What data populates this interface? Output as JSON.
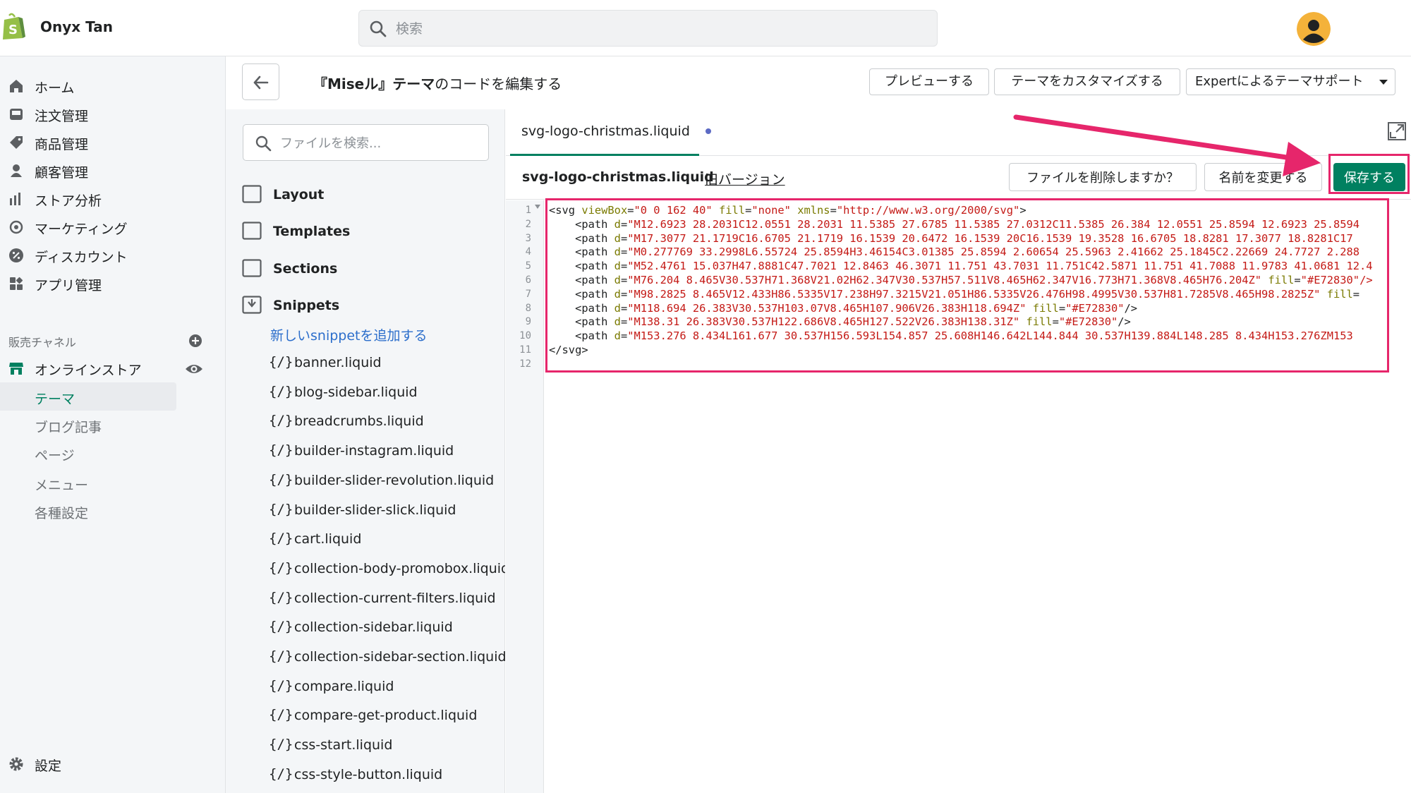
{
  "topbar": {
    "store_name": "Onyx Tan",
    "search_placeholder": "検索"
  },
  "sidebar": {
    "items": [
      {
        "label": "ホーム",
        "icon": "home-icon"
      },
      {
        "label": "注文管理",
        "icon": "orders-icon"
      },
      {
        "label": "商品管理",
        "icon": "tag-icon"
      },
      {
        "label": "顧客管理",
        "icon": "person-icon"
      },
      {
        "label": "ストア分析",
        "icon": "analytics-icon"
      },
      {
        "label": "マーケティング",
        "icon": "target-icon"
      },
      {
        "label": "ディスカウント",
        "icon": "discount-icon"
      },
      {
        "label": "アプリ管理",
        "icon": "apps-icon"
      }
    ],
    "channels_heading": "販売チャネル",
    "online_store": "オンラインストア",
    "sub_items": [
      {
        "label": "テーマ",
        "active": true
      },
      {
        "label": "ブログ記事",
        "active": false
      },
      {
        "label": "ページ",
        "active": false
      },
      {
        "label": "メニュー",
        "active": false
      },
      {
        "label": "各種設定",
        "active": false
      }
    ],
    "settings": "設定"
  },
  "header": {
    "title_quote_open": "『",
    "title_theme": "Miseル",
    "title_quote_close": "』テーマ",
    "title_rest": "のコードを編集する",
    "preview_button": "プレビューする",
    "customize_button": "テーマをカスタマイズする",
    "expert_button": "Expertによるテーマサポート"
  },
  "files": {
    "search_placeholder": "ファイルを検索...",
    "folders": [
      "Layout",
      "Templates",
      "Sections",
      "Snippets"
    ],
    "add_snippet": "新しいsnippetを追加する",
    "file_icon": "{/}",
    "snippets": [
      "banner.liquid",
      "blog-sidebar.liquid",
      "breadcrumbs.liquid",
      "builder-instagram.liquid",
      "builder-slider-revolution.liquid",
      "builder-slider-slick.liquid",
      "cart.liquid",
      "collection-body-promobox.liquid",
      "collection-current-filters.liquid",
      "collection-sidebar.liquid",
      "collection-sidebar-section.liquid",
      "compare.liquid",
      "compare-get-product.liquid",
      "css-start.liquid",
      "css-style-button.liquid"
    ]
  },
  "editor": {
    "tab_name": "svg-logo-christmas.liquid",
    "file_name": "svg-logo-christmas.liquid",
    "old_version": "旧バージョン",
    "delete_button": "ファイルを削除しますか？",
    "rename_button": "名前を変更する",
    "save_button": "保存する",
    "line_numbers": [
      "1",
      "2",
      "3",
      "4",
      "5",
      "6",
      "7",
      "8",
      "9",
      "10",
      "11",
      "12"
    ],
    "code_lines": [
      [
        {
          "t": "tag",
          "v": "<svg "
        },
        {
          "t": "attr",
          "v": "viewBox"
        },
        {
          "t": "tag",
          "v": "="
        },
        {
          "t": "str",
          "v": "\"0 0 162 40\""
        },
        {
          "t": "tag",
          "v": " "
        },
        {
          "t": "attr",
          "v": "fill"
        },
        {
          "t": "tag",
          "v": "="
        },
        {
          "t": "str",
          "v": "\"none\""
        },
        {
          "t": "tag",
          "v": " "
        },
        {
          "t": "attr",
          "v": "xmlns"
        },
        {
          "t": "tag",
          "v": "="
        },
        {
          "t": "str",
          "v": "\"http://www.w3.org/2000/svg\""
        },
        {
          "t": "tag",
          "v": ">"
        }
      ],
      [
        {
          "t": "tag",
          "v": "    <path "
        },
        {
          "t": "attr",
          "v": "d"
        },
        {
          "t": "tag",
          "v": "="
        },
        {
          "t": "str",
          "v": "\"M12.6923 28.2031C12.0551 28.2031 11.5385 27.6785 11.5385 27.0312C11.5385 26.384 12.0551 25.8594 12.6923 25.8594"
        }
      ],
      [
        {
          "t": "tag",
          "v": "    <path "
        },
        {
          "t": "attr",
          "v": "d"
        },
        {
          "t": "tag",
          "v": "="
        },
        {
          "t": "str",
          "v": "\"M17.3077 21.1719C16.6705 21.1719 16.1539 20.6472 16.1539 20C16.1539 19.3528 16.6705 18.8281 17.3077 18.8281C17"
        }
      ],
      [
        {
          "t": "tag",
          "v": "    <path "
        },
        {
          "t": "attr",
          "v": "d"
        },
        {
          "t": "tag",
          "v": "="
        },
        {
          "t": "str",
          "v": "\"M0.277769 33.2998L6.55724 25.8594H3.46154C3.01385 25.8594 2.60654 25.5963 2.41662 25.1845C2.22669 24.7727 2.288"
        }
      ],
      [
        {
          "t": "tag",
          "v": "    <path "
        },
        {
          "t": "attr",
          "v": "d"
        },
        {
          "t": "tag",
          "v": "="
        },
        {
          "t": "str",
          "v": "\"M52.4761 15.037H47.8881C47.7021 12.8463 46.3071 11.751 43.7031 11.751C42.5871 11.751 41.7088 11.9783 41.0681 12.4"
        }
      ],
      [
        {
          "t": "tag",
          "v": "    <path "
        },
        {
          "t": "attr",
          "v": "d"
        },
        {
          "t": "tag",
          "v": "="
        },
        {
          "t": "str",
          "v": "\"M76.204 8.465V30.537H71.368V21.02H62.347V30.537H57.511V8.465H62.347V16.773H71.368V8.465H76.204Z\""
        },
        {
          "t": "tag",
          "v": " "
        },
        {
          "t": "attr",
          "v": "fill"
        },
        {
          "t": "tag",
          "v": "="
        },
        {
          "t": "str",
          "v": "\"#E72830\"/>"
        }
      ],
      [
        {
          "t": "tag",
          "v": "    <path "
        },
        {
          "t": "attr",
          "v": "d"
        },
        {
          "t": "tag",
          "v": "="
        },
        {
          "t": "str",
          "v": "\"M98.2825 8.465V12.433H86.5335V17.238H97.3215V21.051H86.5335V26.476H98.4995V30.537H81.7285V8.465H98.2825Z\""
        },
        {
          "t": "tag",
          "v": " "
        },
        {
          "t": "attr",
          "v": "fill"
        },
        {
          "t": "tag",
          "v": "="
        }
      ],
      [
        {
          "t": "tag",
          "v": "    <path "
        },
        {
          "t": "attr",
          "v": "d"
        },
        {
          "t": "tag",
          "v": "="
        },
        {
          "t": "str",
          "v": "\"M118.694 26.383V30.537H103.07V8.465H107.906V26.383H118.694Z\""
        },
        {
          "t": "tag",
          "v": " "
        },
        {
          "t": "attr",
          "v": "fill"
        },
        {
          "t": "tag",
          "v": "="
        },
        {
          "t": "str",
          "v": "\"#E72830\""
        },
        {
          "t": "tag",
          "v": "/>"
        }
      ],
      [
        {
          "t": "tag",
          "v": "    <path "
        },
        {
          "t": "attr",
          "v": "d"
        },
        {
          "t": "tag",
          "v": "="
        },
        {
          "t": "str",
          "v": "\"M138.31 26.383V30.537H122.686V8.465H127.522V26.383H138.31Z\""
        },
        {
          "t": "tag",
          "v": " "
        },
        {
          "t": "attr",
          "v": "fill"
        },
        {
          "t": "tag",
          "v": "="
        },
        {
          "t": "str",
          "v": "\"#E72830\""
        },
        {
          "t": "tag",
          "v": "/>"
        }
      ],
      [
        {
          "t": "tag",
          "v": "    <path "
        },
        {
          "t": "attr",
          "v": "d"
        },
        {
          "t": "tag",
          "v": "="
        },
        {
          "t": "str",
          "v": "\"M153.276 8.434L161.677 30.537H156.593L154.857 25.608H146.642L144.844 30.537H139.884L148.285 8.434H153.276ZM153"
        }
      ],
      [
        {
          "t": "tag",
          "v": "</svg>"
        }
      ],
      []
    ]
  },
  "colors": {
    "primary": "#008060",
    "annotation": "#e6266b",
    "link": "#2c6ecb",
    "unsaved_dot": "#5c6ac4"
  }
}
